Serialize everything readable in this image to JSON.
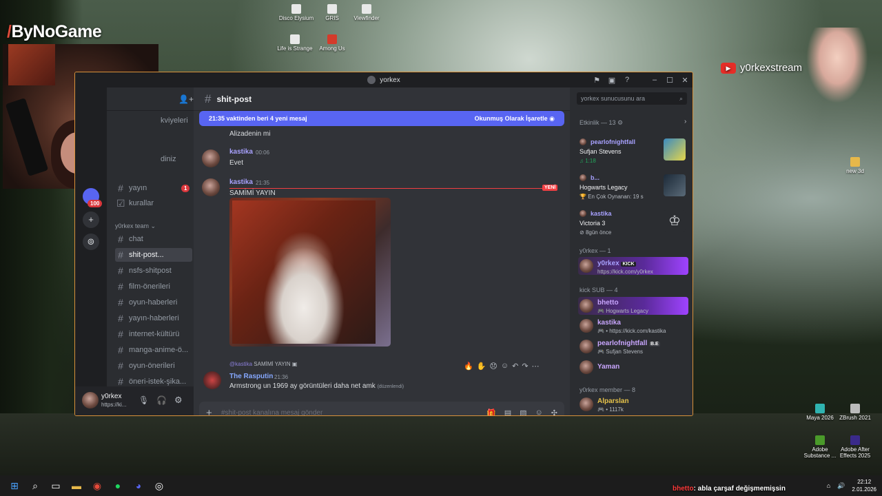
{
  "brand": {
    "logo_text": "ByNoGame",
    "youtube_handle": "y0rkexstream"
  },
  "desktop_icons": [
    {
      "label": "Disco Elysium"
    },
    {
      "label": "GRIS"
    },
    {
      "label": "Viewfinder"
    },
    {
      "label": "Life is Strange"
    },
    {
      "label": "Among Us"
    },
    {
      "label": "new 3d"
    },
    {
      "label": "Maya 2026"
    },
    {
      "label": "ZBrush 2021"
    },
    {
      "label": "Adobe Substance ..."
    },
    {
      "label": "Adobe After Effects 2025"
    }
  ],
  "window": {
    "title": "yorkex"
  },
  "guilds": {
    "unread_badge": "100",
    "dm_badge": "1"
  },
  "channels": {
    "header_fragment": "kviyeleri",
    "cut_item": "diniz",
    "partial_item": "yayın",
    "rules": "kurallar",
    "category": "y0rkex team",
    "items": [
      {
        "label": "chat"
      },
      {
        "label": "shit-post..."
      },
      {
        "label": "nsfs-shitpost"
      },
      {
        "label": "film-önerileri"
      },
      {
        "label": "oyun-haberleri"
      },
      {
        "label": "yayın-haberleri"
      },
      {
        "label": "internet-kültürü"
      },
      {
        "label": "manga-anime-ö..."
      },
      {
        "label": "oyun-önerileri"
      },
      {
        "label": "öneri-istek-şika..."
      }
    ]
  },
  "user_panel": {
    "name": "y0rkex",
    "status": "https://ki..."
  },
  "chat": {
    "channel_name": "shit-post",
    "new_messages_bar": "21:35 vaktinden beri 4 yeni mesaj",
    "mark_read": "Okunmuş Olarak İşaretle",
    "new_tag": "YENİ",
    "messages": [
      {
        "author": "",
        "time": "",
        "text": "Alizadenin mi"
      },
      {
        "author": "kastika",
        "time": "00:06",
        "text": "Evet"
      },
      {
        "author": "kastika",
        "time": "21:35",
        "text": "SAMİMİ YAYIN"
      },
      {
        "author": "The Rasputin",
        "time": "21:36",
        "text": "Armstrong un 1969 ay görüntüleri daha net amk",
        "edited": "(düzenlendi)"
      }
    ],
    "reply_to": {
      "author": "@kastika",
      "text": "SAMİMİ YAYIN"
    },
    "composer_placeholder": "#shit-post kanalına mesaj gönder"
  },
  "members": {
    "search_placeholder": "yorkex sunucusunu ara",
    "activity_header": "Etkinlik — 13",
    "activities": [
      {
        "user": "pearlofnightfall",
        "title": "Sufjan Stevens",
        "sub": "1:18"
      },
      {
        "user": "b...",
        "title": "Hogwarts Legacy",
        "sub": "En Çok Oynanan: 19 s"
      },
      {
        "user": "kastika",
        "title": "Victoria 3",
        "sub": "8gün önce"
      }
    ],
    "groups": [
      {
        "header": "y0rkex — 1",
        "members": [
          {
            "name": "y0rkex",
            "tag": "KICK",
            "sub": "https://kick.com/y0rkex"
          }
        ]
      },
      {
        "header": "kick SUB — 4",
        "members": [
          {
            "name": "bhetto",
            "sub": "Hogwarts Legacy"
          },
          {
            "name": "kastika",
            "sub": "• https://kick.com/kastika"
          },
          {
            "name": "pearlofnightfall",
            "tag": "B.E",
            "sub": "Sufjan Stevens"
          },
          {
            "name": "Yaman",
            "sub": ""
          }
        ]
      },
      {
        "header": "y0rkex member — 8",
        "members": [
          {
            "name": "Alparslan",
            "sub": "• 1117k"
          }
        ]
      }
    ]
  },
  "taskbar": {
    "chat_overlay": {
      "user": "bhetto",
      "text": ": abla çarşaf değişmemişsin"
    },
    "time": "22:12",
    "date": "2.01.2026"
  },
  "colors": {
    "accent": "#5865f2",
    "window_border": "#d9923b",
    "new_line": "#f23f43",
    "kick_purple": "#9f43ff"
  }
}
